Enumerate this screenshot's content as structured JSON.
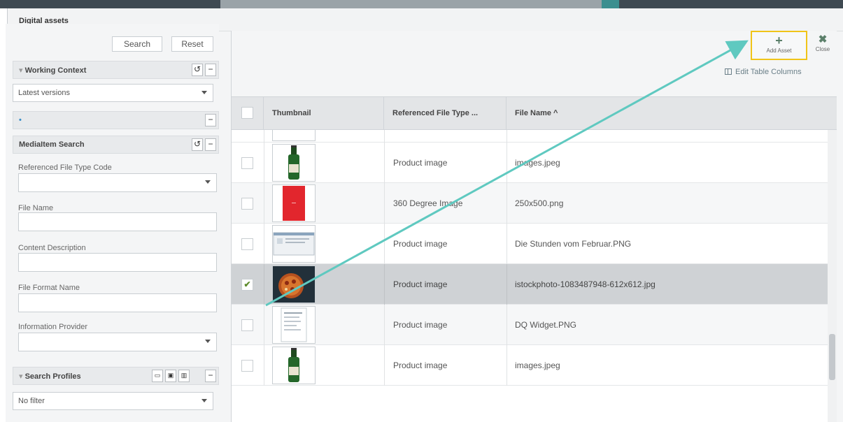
{
  "dialog": {
    "title": "Digital assets"
  },
  "left": {
    "search_label": "Search",
    "reset_label": "Reset",
    "working_context": {
      "title": "Working Context",
      "select_value": "Latest versions"
    },
    "dot_section": "•",
    "mediaitem_search": {
      "title": "MediaItem Search",
      "fields": [
        {
          "label": "Referenced File Type Code",
          "type": "select",
          "value": ""
        },
        {
          "label": "File Name",
          "type": "text",
          "value": ""
        },
        {
          "label": "Content Description",
          "type": "text",
          "value": ""
        },
        {
          "label": "File Format Name",
          "type": "text",
          "value": ""
        },
        {
          "label": "Information Provider",
          "type": "select",
          "value": ""
        }
      ]
    },
    "search_profiles": {
      "title": "Search Profiles",
      "select_value": "No filter"
    }
  },
  "toolbar": {
    "add_asset_label": "Add Asset",
    "close_label": "Close",
    "edit_columns_label": "Edit Table Columns"
  },
  "table": {
    "columns": [
      "Thumbnail",
      "Referenced File Type ...",
      "File Name ^"
    ],
    "rows": [
      {
        "thumb": "beer-bottle",
        "type": "Product image",
        "file": "images.jpeg",
        "checked": false
      },
      {
        "thumb": "red-image",
        "type": "360 Degree Image",
        "file": "250x500.png",
        "checked": false
      },
      {
        "thumb": "screenshot",
        "type": "Product image",
        "file": "Die Stunden vom Februar.PNG",
        "checked": false
      },
      {
        "thumb": "pizza",
        "type": "Product image",
        "file": "istockphoto-1083487948-612x612.jpg",
        "checked": true
      },
      {
        "thumb": "document",
        "type": "Product image",
        "file": "DQ Widget.PNG",
        "checked": false
      },
      {
        "thumb": "beer-bottle",
        "type": "Product image",
        "file": "images.jpeg",
        "checked": false
      }
    ]
  },
  "colors": {
    "accent": "#5fc9c0",
    "highlight_border": "#f0c419",
    "selected_row": "#cfd2d5"
  },
  "icons": [
    "plus-icon",
    "close-icon",
    "reset-icon",
    "collapse-icon",
    "dropdown-arrow-icon",
    "columns-icon",
    "checkmark-icon"
  ]
}
